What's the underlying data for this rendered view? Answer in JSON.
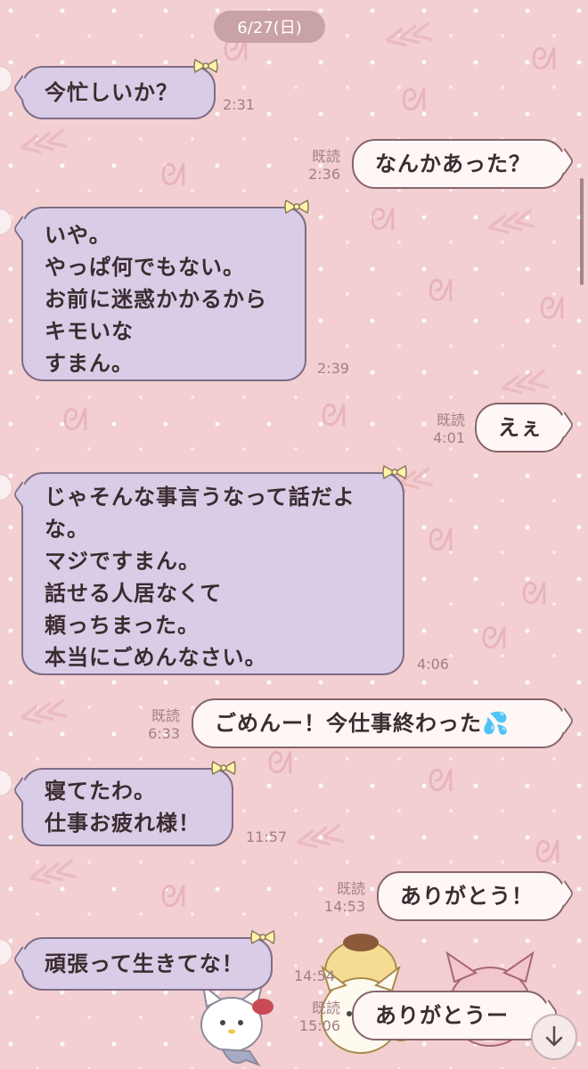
{
  "date_label": "6/27(日)",
  "read_label": "既読",
  "messages": [
    {
      "side": "in",
      "lines": [
        "今忙しいか？"
      ],
      "time": "2:31"
    },
    {
      "side": "out",
      "lines": [
        "なんかあった？"
      ],
      "time": "2:36",
      "read": true
    },
    {
      "side": "in",
      "lines": [
        "いや。",
        "やっぱ何でもない。",
        "お前に迷惑かかるから",
        "キモいな",
        "すまん。"
      ],
      "time": "2:39"
    },
    {
      "side": "out",
      "lines": [
        "えぇ"
      ],
      "time": "4:01",
      "read": true
    },
    {
      "side": "in",
      "lines": [
        "じゃそんな事言うなって話だよ",
        "な。",
        "マジですまん。",
        "話せる人居なくて",
        "頼っちまった。",
        "本当にごめんなさい。"
      ],
      "time": "4:06"
    },
    {
      "side": "out",
      "lines": [
        "ごめんー！今仕事終わった"
      ],
      "emoji": "💦",
      "time": "6:33",
      "read": true
    },
    {
      "side": "in",
      "lines": [
        "寝てたわ。",
        "仕事お疲れ様！"
      ],
      "time": "11:57"
    },
    {
      "side": "out",
      "lines": [
        "ありがとう！"
      ],
      "time": "14:53",
      "read": true
    },
    {
      "side": "in",
      "lines": [
        "頑張って生きてな！"
      ],
      "time": "14:54"
    },
    {
      "side": "out",
      "lines": [
        "ありがとうー"
      ],
      "time": "15:06",
      "read": true
    }
  ],
  "colors": {
    "background": "#f3cfd2",
    "incoming_bubble": "#d9cce6",
    "outgoing_bubble": "#fff6f6",
    "meta_text": "#a07f84"
  },
  "icons": {
    "scroll_down": "arrow-down-icon",
    "bubble_bow": "ribbon-bow-icon"
  }
}
